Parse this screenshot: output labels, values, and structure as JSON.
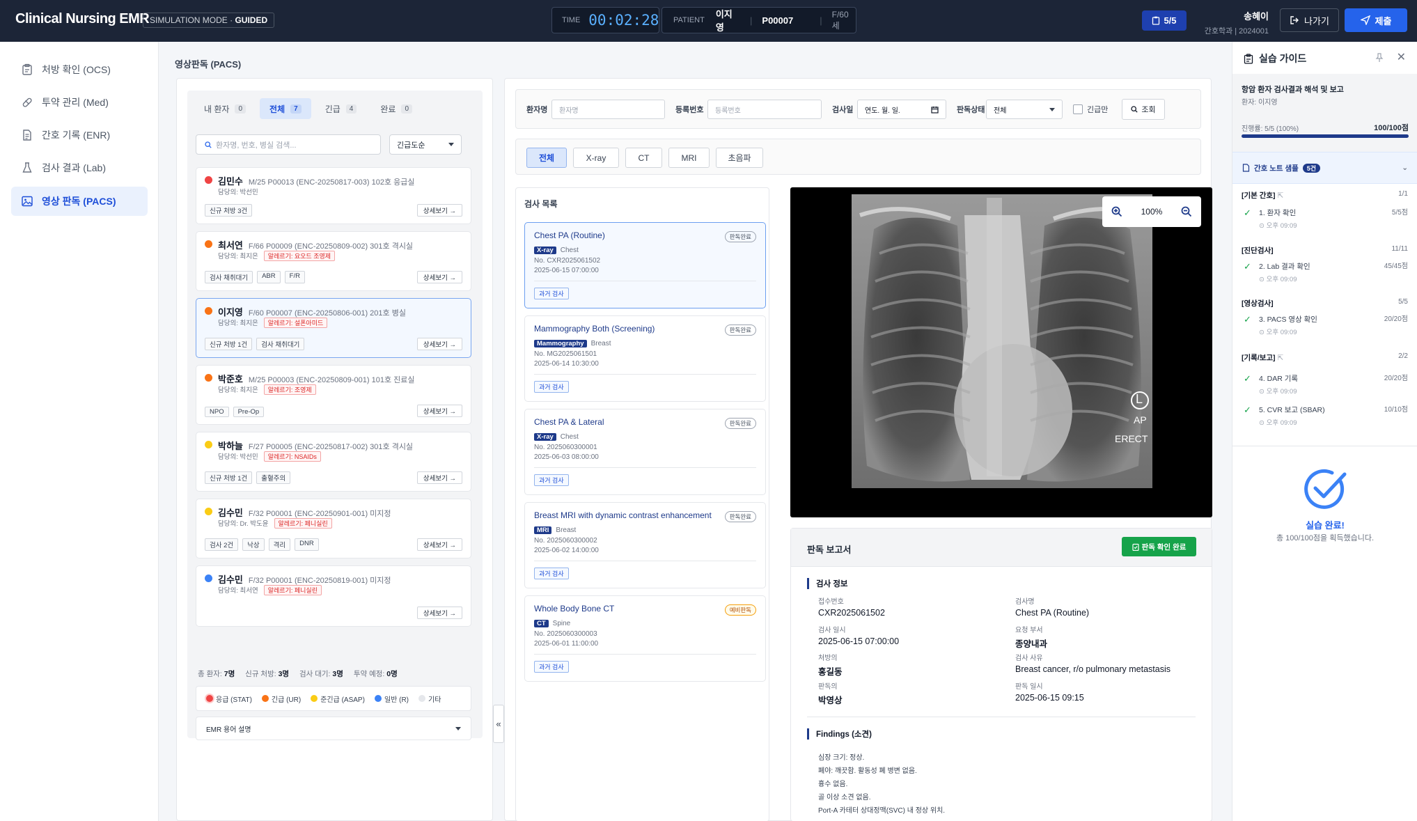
{
  "header": {
    "brand": "Clinical Nursing EMR",
    "mode_prefix": "SIMULATION MODE · ",
    "mode_value": "GUIDED",
    "time_label": "TIME",
    "time_value": "00:02:28",
    "patient_label": "PATIENT",
    "patient_name": "이지영",
    "patient_id": "P00007",
    "patient_sex_age": "F/60세",
    "score": "5/5",
    "user_name": "송혜이",
    "user_dept": "간호학과 | 2024001",
    "exit_label": "나가기",
    "submit_label": "제출"
  },
  "sidebar": {
    "items": [
      {
        "label": "처방 확인 (OCS)"
      },
      {
        "label": "투약 관리 (Med)"
      },
      {
        "label": "간호 기록 (ENR)"
      },
      {
        "label": "검사 결과 (Lab)"
      },
      {
        "label": "영상 판독 (PACS)"
      }
    ]
  },
  "page_title": "영상판독 (PACS)",
  "patients": {
    "tabs": [
      {
        "label": "내 환자",
        "count": "0"
      },
      {
        "label": "전체",
        "count": "7"
      },
      {
        "label": "긴급",
        "count": "4"
      },
      {
        "label": "완료",
        "count": "0"
      }
    ],
    "search_placeholder": "환자명, 번호, 병실 검색...",
    "sort_value": "긴급도순",
    "detail_label": "상세보기 →",
    "list": [
      {
        "name": "김민수",
        "info": "M/25  P00013 (ENC-20250817-003)  102호 응급실",
        "doctor": "담당의: 박선민",
        "allergy": "",
        "tags": [
          "신규 처방 3건"
        ]
      },
      {
        "name": "최서연",
        "info": "F/66  P00009 (ENC-20250809-002)  301호 격시실",
        "doctor": "담당의: 최지은",
        "allergy": "알레르기: 요오드 조영제",
        "tags": [
          "검사 채취대기",
          "ABR",
          "F/R"
        ]
      },
      {
        "name": "이지영",
        "info": "F/60  P00007 (ENC-20250806-001)  201호 병실",
        "doctor": "담당의: 최지은",
        "allergy": "알레르기: 설폰아미드",
        "tags": [
          "신규 처방 1건",
          "검사 채취대기"
        ]
      },
      {
        "name": "박준호",
        "info": "M/25  P00003 (ENC-20250809-001)  101호 진료실",
        "doctor": "담당의: 최지은",
        "allergy": "알레르기: 조영제",
        "tags": [
          "NPO",
          "Pre-Op"
        ]
      },
      {
        "name": "박하늘",
        "info": "F/27  P00005 (ENC-20250817-002)  301호 격시실",
        "doctor": "담당의: 박선민",
        "allergy": "알레르기: NSAIDs",
        "tags": [
          "신규 처방 1건",
          "출혈주의"
        ]
      },
      {
        "name": "김수민",
        "info": "F/32  P00001 (ENC-20250901-001)  미지정",
        "doctor": "담당의: Dr. 박도윤",
        "allergy": "알레르기: 페니실린",
        "tags": [
          "검사 2건",
          "낙상",
          "격리",
          "DNR"
        ]
      },
      {
        "name": "김수민",
        "info": "F/32  P00001 (ENC-20250819-001)  미지정",
        "doctor": "담당의: 최서연",
        "allergy": "알레르기: 페니실린",
        "tags": []
      }
    ],
    "summary": [
      {
        "label": "총 환자:",
        "value": "7명"
      },
      {
        "label": "신규 처방:",
        "value": "3명"
      },
      {
        "label": "검사 대기:",
        "value": "3명"
      },
      {
        "label": "투약 예정:",
        "value": "0명"
      }
    ],
    "legend": [
      "응급 (STAT)",
      "긴급 (UR)",
      "준긴급 (ASAP)",
      "일반 (R)",
      "기타"
    ],
    "emr_term": "EMR 용어 설명",
    "collapse_icon": "«"
  },
  "filters": {
    "patient_label": "환자명",
    "patient_placeholder": "환자명",
    "reg_label": "등록번호",
    "reg_placeholder": "등록번호",
    "date_label": "검사일",
    "date_value": "연도. 월. 일.",
    "status_label": "판독상태",
    "status_value": "전체",
    "urgent_label": "긴급만",
    "query_label": "조회"
  },
  "modalities": [
    "전체",
    "X-ray",
    "CT",
    "MRI",
    "초음파"
  ],
  "studies": {
    "title": "검사 목록",
    "past_label": "과거 검사",
    "items": [
      {
        "title": "Chest PA (Routine)",
        "status": "판독완료",
        "modality": "X-ray",
        "body": "Chest",
        "no": "No. CXR2025061502",
        "date": "2025-06-15 07:00:00"
      },
      {
        "title": "Mammography Both (Screening)",
        "status": "판독완료",
        "modality": "Mammography",
        "body": "Breast",
        "no": "No. MG2025061501",
        "date": "2025-06-14 10:30:00"
      },
      {
        "title": "Chest PA & Lateral",
        "status": "판독완료",
        "modality": "X-ray",
        "body": "Chest",
        "no": "No. 2025060300001",
        "date": "2025-06-03 08:00:00"
      },
      {
        "title": "Breast MRI with dynamic contrast enhancement",
        "status": "판독완료",
        "modality": "MRI",
        "body": "Breast",
        "no": "No. 2025060300002",
        "date": "2025-06-02 14:00:00"
      },
      {
        "title": "Whole Body Bone CT",
        "status": "예비판독",
        "modality": "CT",
        "body": "Spine",
        "no": "No. 2025060300003",
        "date": "2025-06-01 11:00:00"
      }
    ]
  },
  "viewer": {
    "zoom": "100%",
    "marker": "L",
    "view1": "AP",
    "view2": "ERECT"
  },
  "report": {
    "title": "판독 보고서",
    "confirm_label": "판독 확인 완료",
    "info_title": "검사 정보",
    "fields": {
      "acc_k": "접수번호",
      "acc_v": "CXR2025061502",
      "name_k": "검사명",
      "name_v": "Chest PA (Routine)",
      "date_k": "검사 일시",
      "date_v": "2025-06-15 07:00:00",
      "dept_k": "요청 부서",
      "dept_v": "종양내과",
      "ord_k": "처방의",
      "ord_v": "홍길동",
      "reason_k": "검사 사유",
      "reason_v": "Breast cancer, r/o pulmonary metastasis",
      "reader_k": "판독의",
      "reader_v": "박영상",
      "rdate_k": "판독 일시",
      "rdate_v": "2025-06-15 09:15"
    },
    "findings_title": "Findings (소견)",
    "findings": [
      "심장 크기: 정상.",
      "폐야: 깨끗함. 활동성 폐 병변 없음.",
      "흉수 없음.",
      "골 이상 소견 없음.",
      "Port-A 카테터 상대정맥(SVC) 내 정상 위치."
    ]
  },
  "guide": {
    "title": "실습 가이드",
    "scenario": "항암 환자 검사결과 해석 및 보고",
    "patient": "환자: 이지영",
    "progress_label": "진행률: 5/5 (100%)",
    "progress_value": "100/100점",
    "progress_pct": 100,
    "note_label": "간호 노트 샘플",
    "note_count": "5건",
    "categories": [
      {
        "name": "[기본 간호]",
        "count": "1/1",
        "step": "1. 환자 확인",
        "score": "5/5점",
        "time": "⊙ 오후 09:09"
      },
      {
        "name": "[진단검사]",
        "count": "11/11",
        "step": "2. Lab 결과 확인",
        "score": "45/45점",
        "time": "⊙ 오후 09:09"
      },
      {
        "name": "[영상검사]",
        "count": "5/5",
        "step": "3. PACS 영상 확인",
        "score": "20/20점",
        "time": "⊙ 오후 09:09"
      },
      {
        "name": "[기록/보고]",
        "count": "2/2",
        "step": "4. DAR 기록",
        "score": "20/20점",
        "time": "⊙ 오후 09:09"
      }
    ],
    "extra_step": {
      "step": "5. CVR 보고 (SBAR)",
      "score": "10/10점",
      "time": "⊙ 오후 09:09"
    },
    "done_title": "실습 완료!",
    "done_sub": "총 100/100점을 획득했습니다."
  }
}
